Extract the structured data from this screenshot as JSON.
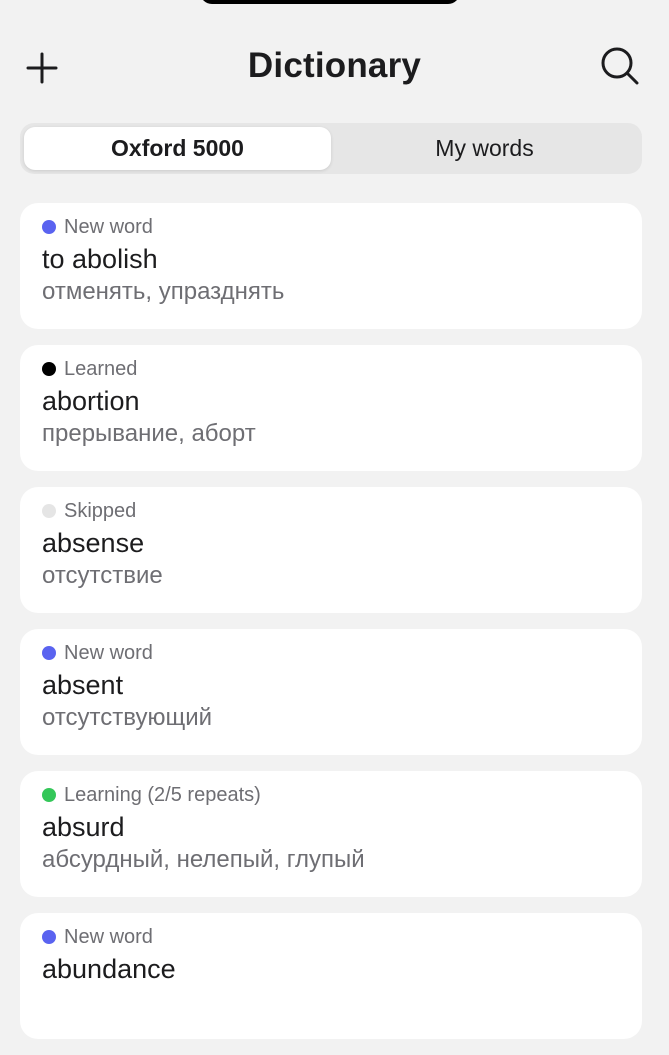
{
  "header": {
    "title": "Dictionary",
    "add_icon": "plus-icon",
    "search_icon": "search-icon"
  },
  "tabs": [
    {
      "label": "Oxford 5000",
      "active": true
    },
    {
      "label": "My words",
      "active": false
    }
  ],
  "status_colors": {
    "new": "#5a63f0",
    "learned": "#000000",
    "skipped": "#e5e5e5",
    "learning": "#34c759"
  },
  "words": [
    {
      "status": "New word",
      "status_key": "new",
      "word": "to abolish",
      "translation": "отменять, упразднять"
    },
    {
      "status": "Learned",
      "status_key": "learned",
      "word": "abortion",
      "translation": "прерывание, аборт"
    },
    {
      "status": "Skipped",
      "status_key": "skipped",
      "word": "absense",
      "translation": "отсутствие"
    },
    {
      "status": "New word",
      "status_key": "new",
      "word": "absent",
      "translation": "отсутствующий"
    },
    {
      "status": "Learning (2/5 repeats)",
      "status_key": "learning",
      "word": "absurd",
      "translation": "абсурдный, нелепый, глупый"
    },
    {
      "status": "New word",
      "status_key": "new",
      "word": "abundance",
      "translation": ""
    }
  ]
}
